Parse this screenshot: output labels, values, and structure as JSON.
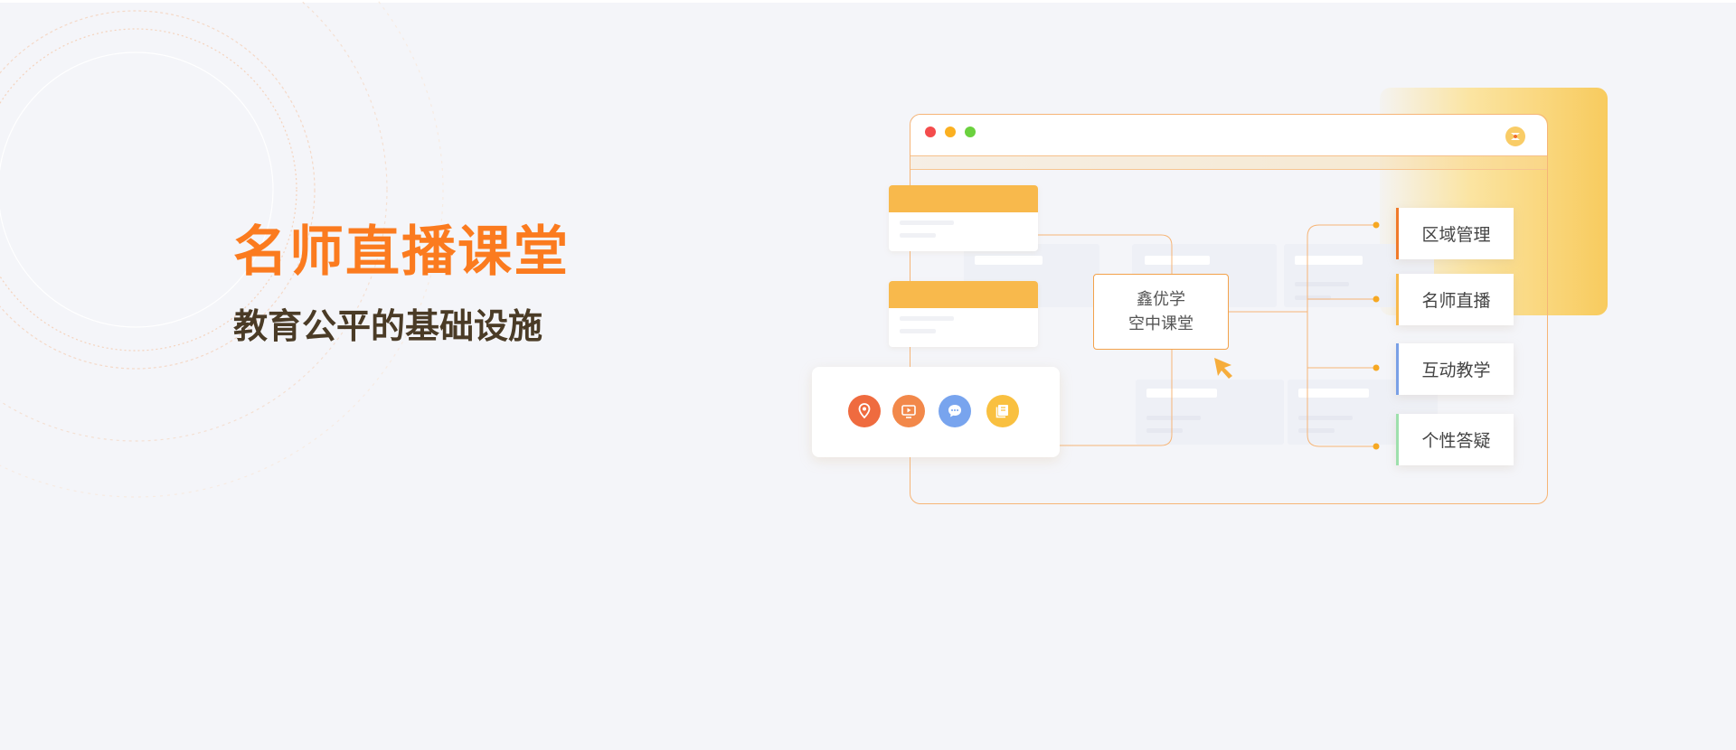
{
  "hero": {
    "title": "名师直播课堂",
    "subtitle": "教育公平的基础设施"
  },
  "diagram": {
    "center_line1": "鑫优学",
    "center_line2": "空中课堂",
    "features": [
      {
        "label": "区域管理",
        "accent": "#f07a2a"
      },
      {
        "label": "名师直播",
        "accent": "#f8b94c"
      },
      {
        "label": "互动教学",
        "accent": "#7aa0e6"
      },
      {
        "label": "个性答疑",
        "accent": "#9ee0ad"
      }
    ],
    "tools": [
      {
        "icon": "location-icon",
        "color": "#ef6b3f"
      },
      {
        "icon": "video-play-icon",
        "color": "#f2884a"
      },
      {
        "icon": "chat-bubble-icon",
        "color": "#78a4ee"
      },
      {
        "icon": "book-icon",
        "color": "#f9c040"
      }
    ]
  },
  "colors": {
    "brand_orange": "#fb7b1f",
    "heading_dark": "#4a3b26",
    "line_orange": "#f6b577"
  }
}
